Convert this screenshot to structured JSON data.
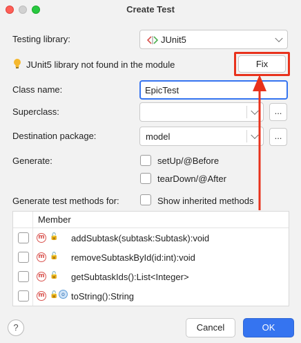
{
  "window": {
    "title": "Create Test"
  },
  "testing_library": {
    "label": "Testing library:",
    "value": "JUnit5"
  },
  "warning": {
    "text": "JUnit5 library not found in the module",
    "fix_label": "Fix"
  },
  "class_name": {
    "label": "Class name:",
    "value": "EpicTest"
  },
  "superclass": {
    "label": "Superclass:",
    "value": "",
    "browse_label": "..."
  },
  "destination": {
    "label": "Destination package:",
    "value": "model",
    "browse_label": "..."
  },
  "generate": {
    "label": "Generate:",
    "options": [
      {
        "label": "setUp/@Before",
        "checked": false
      },
      {
        "label": "tearDown/@After",
        "checked": false
      }
    ]
  },
  "methods_section": {
    "label": "Generate test methods for:",
    "show_inherited_label": "Show inherited methods",
    "show_inherited_checked": false
  },
  "table": {
    "header": "Member",
    "rows": [
      {
        "method": "addSubtask(subtask:Subtask):void",
        "icons": [
          "method-icon",
          "public-lock-icon"
        ],
        "checked": false
      },
      {
        "method": "removeSubtaskById(id:int):void",
        "icons": [
          "method-icon",
          "public-lock-icon"
        ],
        "checked": false
      },
      {
        "method": "getSubtaskIds():List<Integer>",
        "icons": [
          "method-icon",
          "public-lock-icon"
        ],
        "checked": false
      },
      {
        "method": "toString():String",
        "icons": [
          "method-icon",
          "public-lock-icon",
          "override-icon"
        ],
        "checked": false
      }
    ]
  },
  "buttons": {
    "help": "?",
    "cancel": "Cancel",
    "ok": "OK"
  },
  "colors": {
    "accent": "#3574f0",
    "highlight": "#e8321c",
    "method_icon": "#d9534f"
  }
}
